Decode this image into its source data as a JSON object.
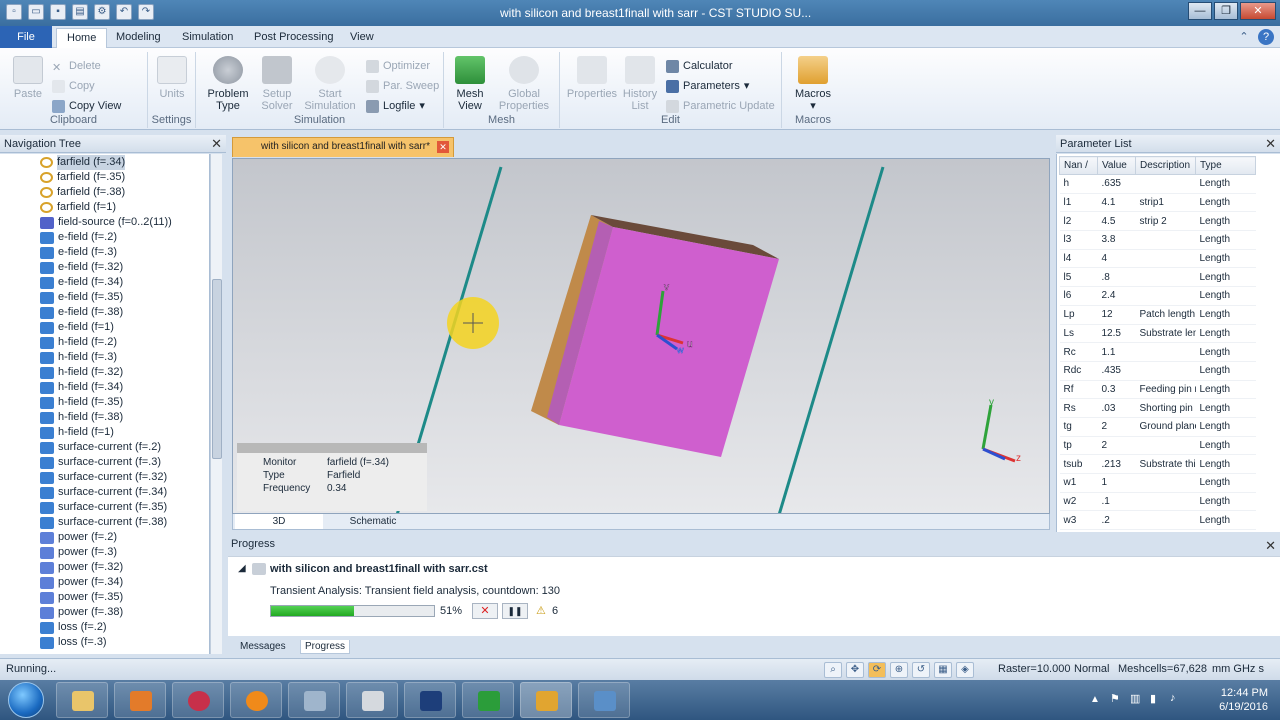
{
  "app": {
    "title": "with silicon and breast1finall with sarr - CST STUDIO SU...",
    "quick_access_icons": [
      "new-icon",
      "open-icon",
      "save-icon",
      "print-icon",
      "settings-icon",
      "undo-icon",
      "redo-icon"
    ],
    "window_buttons": [
      "—",
      "❐",
      "✕"
    ]
  },
  "ribbon": {
    "tabs": [
      "File",
      "Home",
      "Modeling",
      "Simulation",
      "Post Processing",
      "View"
    ],
    "active_tab": "Home",
    "clipboard": {
      "paste": "Paste",
      "delete": "Delete",
      "copy": "Copy",
      "copy_view": "Copy View",
      "label": "Clipboard"
    },
    "settings": {
      "units": "Units",
      "label": "Settings"
    },
    "simulation": {
      "problem_type": [
        "Problem",
        "Type"
      ],
      "setup_solver": [
        "Setup",
        "Solver"
      ],
      "start_simulation": [
        "Start",
        "Simulation"
      ],
      "optimizer": "Optimizer",
      "par_sweep": "Par. Sweep",
      "logfile": "Logfile",
      "label": "Simulation"
    },
    "mesh": {
      "mesh_view": [
        "Mesh",
        "View"
      ],
      "global_properties": [
        "Global",
        "Properties"
      ],
      "label": "Mesh"
    },
    "edit": {
      "properties": "Properties",
      "history_list": [
        "History",
        "List"
      ],
      "calculator": "Calculator",
      "parameters": "Parameters",
      "parametric_update": "Parametric Update",
      "label": "Edit"
    },
    "macros": {
      "macros": "Macros",
      "label": "Macros"
    }
  },
  "nav": {
    "header": "Navigation Tree",
    "items": [
      {
        "label": "farfield (f=.34)",
        "icon": "farfield",
        "selected": true
      },
      {
        "label": "farfield (f=.35)",
        "icon": "farfield"
      },
      {
        "label": "farfield (f=.38)",
        "icon": "farfield"
      },
      {
        "label": "farfield (f=1)",
        "icon": "farfield"
      },
      {
        "label": "field-source (f=0..2(11))",
        "icon": "source"
      },
      {
        "label": "e-field (f=.2)",
        "icon": "field"
      },
      {
        "label": "e-field (f=.3)",
        "icon": "field"
      },
      {
        "label": "e-field (f=.32)",
        "icon": "field"
      },
      {
        "label": "e-field (f=.34)",
        "icon": "field"
      },
      {
        "label": "e-field (f=.35)",
        "icon": "field"
      },
      {
        "label": "e-field (f=.38)",
        "icon": "field"
      },
      {
        "label": "e-field (f=1)",
        "icon": "field"
      },
      {
        "label": "h-field (f=.2)",
        "icon": "field"
      },
      {
        "label": "h-field (f=.3)",
        "icon": "field"
      },
      {
        "label": "h-field (f=.32)",
        "icon": "field"
      },
      {
        "label": "h-field (f=.34)",
        "icon": "field"
      },
      {
        "label": "h-field (f=.35)",
        "icon": "field"
      },
      {
        "label": "h-field (f=.38)",
        "icon": "field"
      },
      {
        "label": "h-field (f=1)",
        "icon": "field"
      },
      {
        "label": "surface-current (f=.2)",
        "icon": "field"
      },
      {
        "label": "surface-current (f=.3)",
        "icon": "field"
      },
      {
        "label": "surface-current (f=.32)",
        "icon": "field"
      },
      {
        "label": "surface-current (f=.34)",
        "icon": "field"
      },
      {
        "label": "surface-current (f=.35)",
        "icon": "field"
      },
      {
        "label": "surface-current (f=.38)",
        "icon": "field"
      },
      {
        "label": "power (f=.2)",
        "icon": "power"
      },
      {
        "label": "power (f=.3)",
        "icon": "power"
      },
      {
        "label": "power (f=.32)",
        "icon": "power"
      },
      {
        "label": "power (f=.34)",
        "icon": "power"
      },
      {
        "label": "power (f=.35)",
        "icon": "power"
      },
      {
        "label": "power (f=.38)",
        "icon": "power"
      },
      {
        "label": "loss (f=.2)",
        "icon": "field"
      },
      {
        "label": "loss (f=.3)",
        "icon": "field"
      }
    ]
  },
  "document": {
    "tab_title": "with silicon and breast1finall with sarr*",
    "monitor_info": [
      {
        "key": "Monitor",
        "value": "farfield (f=.34)"
      },
      {
        "key": "Type",
        "value": "Farfield"
      },
      {
        "key": "Frequency",
        "value": "0.34"
      }
    ],
    "view_tabs": [
      "3D",
      "Schematic"
    ],
    "axis_labels": {
      "v": "v",
      "u": "u",
      "w": "w",
      "y": "y",
      "z": "z"
    }
  },
  "params": {
    "header": "Parameter List",
    "columns": [
      "Nan /",
      "Value",
      "Description",
      "Type"
    ],
    "rows": [
      [
        "h",
        ".635",
        "",
        "Length"
      ],
      [
        "l1",
        "4.1",
        "strip1",
        "Length"
      ],
      [
        "l2",
        "4.5",
        "strip 2",
        "Length"
      ],
      [
        "l3",
        "3.8",
        "",
        "Length"
      ],
      [
        "l4",
        "4",
        "",
        "Length"
      ],
      [
        "l5",
        ".8",
        "",
        "Length"
      ],
      [
        "l6",
        "2.4",
        "",
        "Length"
      ],
      [
        "Lp",
        "12",
        "Patch length",
        "Length"
      ],
      [
        "Ls",
        "12.5",
        "Substrate leng",
        "Length"
      ],
      [
        "Rc",
        "1.1",
        "",
        "Length"
      ],
      [
        "Rdc",
        ".435",
        "",
        "Length"
      ],
      [
        "Rf",
        "0.3",
        "Feeding pin ra",
        "Length"
      ],
      [
        "Rs",
        ".03",
        "Shorting pin ra",
        "Length"
      ],
      [
        "tg",
        "2",
        "Ground plane",
        "Length"
      ],
      [
        "tp",
        "2",
        "",
        "Length"
      ],
      [
        "tsub",
        ".213",
        "Substrate thic",
        "Length"
      ],
      [
        "w1",
        "1",
        "",
        "Length"
      ],
      [
        "w2",
        ".1",
        "",
        "Length"
      ],
      [
        "w3",
        ".2",
        "",
        "Length"
      ]
    ]
  },
  "progress": {
    "header": "Progress",
    "file": "with silicon and breast1finall with sarr.cst",
    "status": "Transient Analysis: Transient field analysis, countdown: 130",
    "percent_label": "51%",
    "percent": 51,
    "warnings": "6",
    "tabs": [
      "Messages",
      "Progress"
    ]
  },
  "statusbar": {
    "status": "Running...",
    "raster": "Raster=10.000",
    "mode": "Normal",
    "meshcells": "Meshcells=67,628",
    "units": "mm  GHz  s"
  },
  "taskbar": {
    "apps": [
      "explorer",
      "media-player",
      "cst",
      "firefox",
      "paint",
      "tool",
      "photoshop",
      "office",
      "cst-studio",
      "monitor"
    ],
    "time": "12:44 PM",
    "date": "6/19/2016"
  }
}
